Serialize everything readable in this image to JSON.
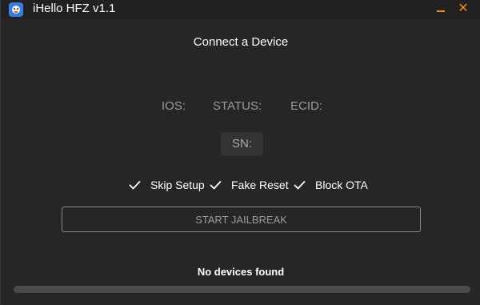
{
  "window": {
    "title": "iHello HFZ v1.1",
    "minimize_icon": "minimize-icon",
    "close_icon": "close-icon",
    "accent_color": "#f08a24"
  },
  "main": {
    "heading": "Connect a Device",
    "info": {
      "ios_label": "IOS:",
      "status_label": "STATUS:",
      "ecid_label": "ECID:",
      "sn_label": "SN:"
    },
    "options": [
      {
        "label": "Skip Setup",
        "checked": true,
        "icon": "checkmark-icon"
      },
      {
        "label": "Fake Reset",
        "checked": true,
        "icon": "checkmark-icon"
      },
      {
        "label": "Block OTA",
        "checked": true,
        "icon": "checkmark-icon"
      }
    ],
    "start_button_label": "START JAILBREAK",
    "status_message": "No devices found",
    "progress_fraction": 0
  }
}
